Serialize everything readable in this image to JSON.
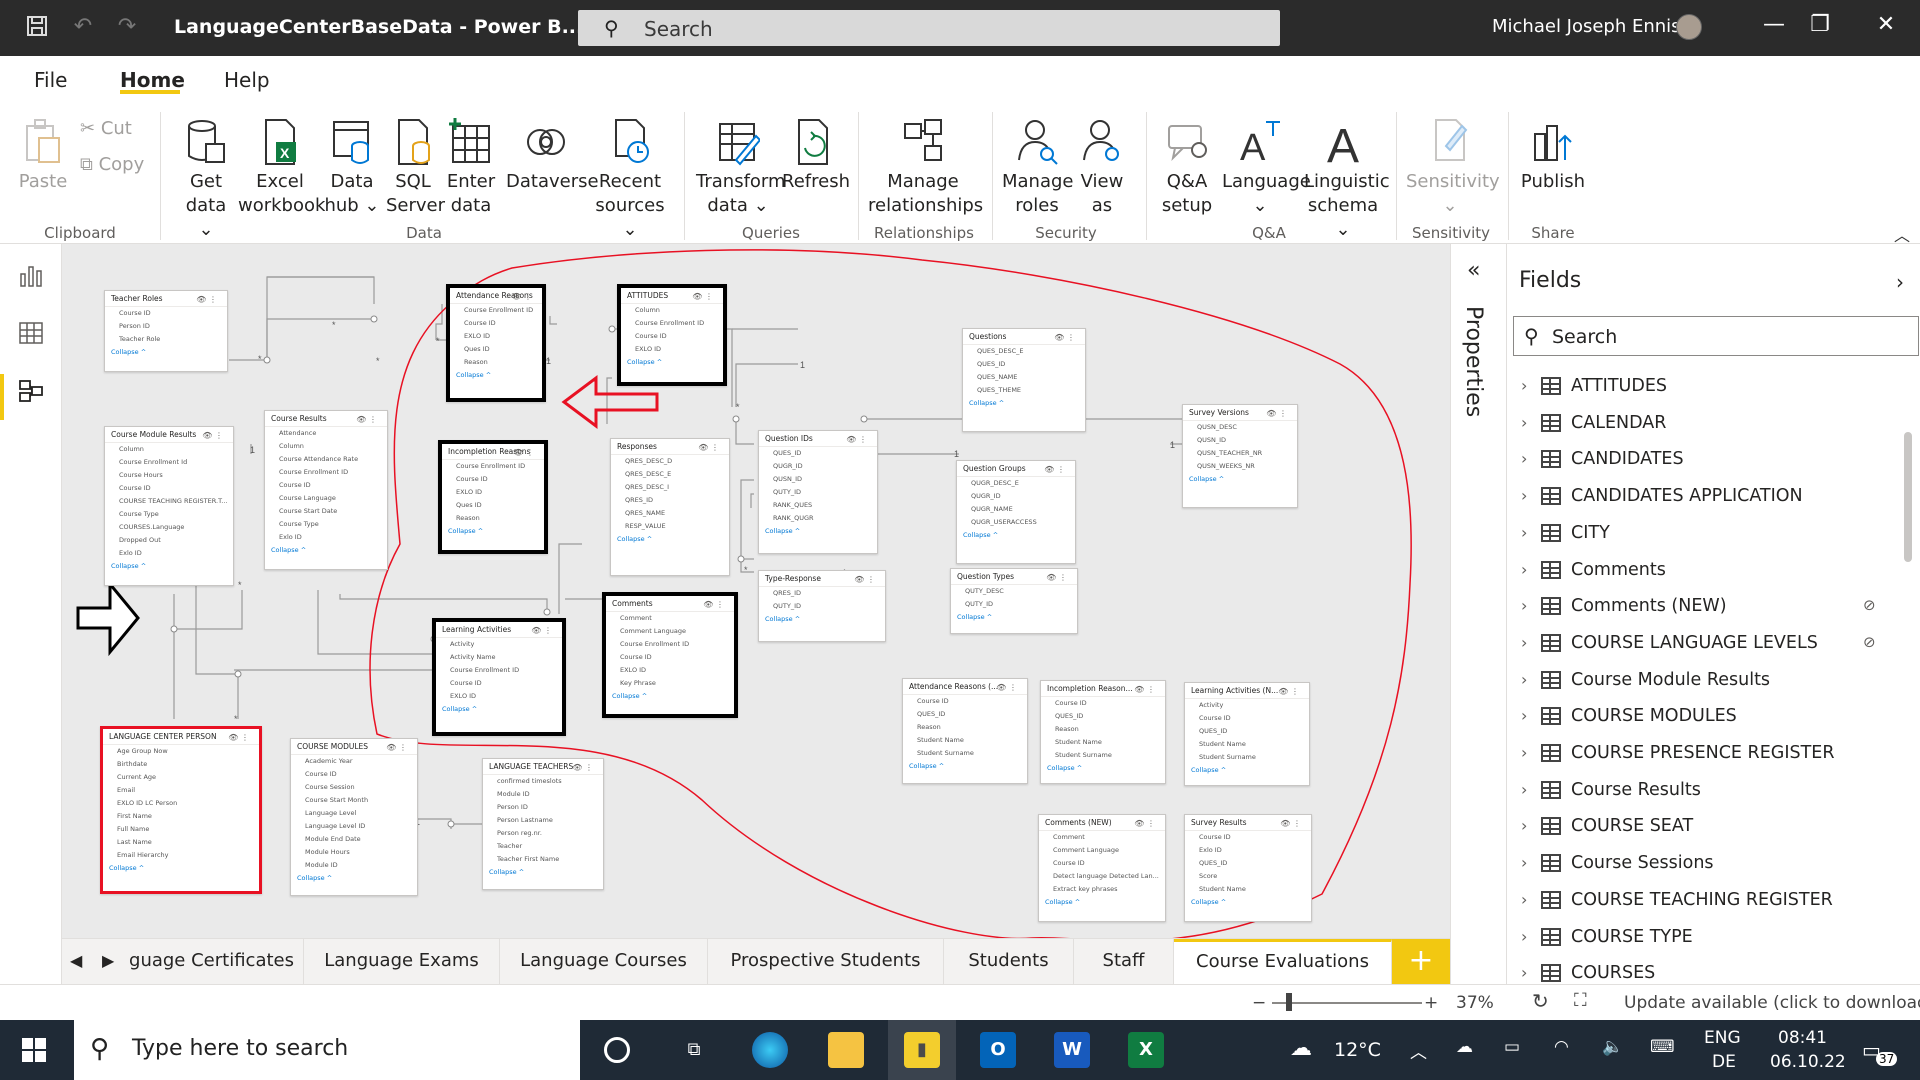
{
  "titlebar": {
    "title": "LanguageCenterBaseData - Power B...",
    "search_placeholder": "Search",
    "user": "Michael Joseph Ennis"
  },
  "menu": {
    "file": "File",
    "home": "Home",
    "help": "Help"
  },
  "ribbon": {
    "paste": "Paste",
    "cut": "Cut",
    "copy": "Copy",
    "get_data": [
      "Get",
      "data ⌄"
    ],
    "excel": [
      "Excel",
      "workbook"
    ],
    "data_hub": [
      "Data",
      "hub ⌄"
    ],
    "sql": [
      "SQL",
      "Server"
    ],
    "enter_data": [
      "Enter",
      "data"
    ],
    "dataverse": [
      "Dataverse"
    ],
    "recent": [
      "Recent",
      "sources ⌄"
    ],
    "transform": [
      "Transform",
      "data ⌄"
    ],
    "refresh": [
      "Refresh"
    ],
    "manage_rel": [
      "Manage",
      "relationships"
    ],
    "manage_roles": [
      "Manage",
      "roles"
    ],
    "view_as": [
      "View",
      "as"
    ],
    "qa_setup": [
      "Q&A",
      "setup"
    ],
    "language": [
      "Language",
      "⌄"
    ],
    "ling": [
      "Linguistic",
      "schema ⌄"
    ],
    "sensitivity": [
      "Sensitivity",
      "⌄"
    ],
    "publish": [
      "Publish"
    ],
    "groups": {
      "clipboard": "Clipboard",
      "data": "Data",
      "queries": "Queries",
      "relationships": "Relationships",
      "security": "Security",
      "qa": "Q&A",
      "sensitivity": "Sensitivity",
      "share": "Share"
    }
  },
  "tables": [
    {
      "id": "t1",
      "title": "Teacher Roles",
      "rows": [
        "Course ID",
        "Person ID",
        "Teacher Role"
      ],
      "hl": ""
    },
    {
      "id": "t2",
      "title": "Attendance Reasons",
      "rows": [
        "Course Enrollment ID",
        "Course ID",
        "EXLO ID",
        "Ques ID",
        "Reason"
      ],
      "hl": "black"
    },
    {
      "id": "t3",
      "title": "ATTITUDES",
      "rows": [
        "Column",
        "Course Enrollment ID",
        "Course ID",
        "EXLO ID"
      ],
      "hl": "black"
    },
    {
      "id": "t4",
      "title": "Questions",
      "rows": [
        "QUES_DESC_E",
        "QUES_ID",
        "QUES_NAME",
        "QUES_THEME"
      ],
      "hl": ""
    },
    {
      "id": "t5",
      "title": "Course Module Results",
      "rows": [
        "Column",
        "Course Enrollment Id",
        "Course Hours",
        "Course ID",
        "COURSE TEACHING REGISTER.T...",
        "Course Type",
        "COURSES.Language",
        "Dropped Out",
        "Exlo ID"
      ],
      "hl": ""
    },
    {
      "id": "t6",
      "title": "Course Results",
      "rows": [
        "Attendance",
        "Column",
        "Course Attendance Rate",
        "Course Enrollment ID",
        "Course ID",
        "Course Language",
        "Course Start Date",
        "Course Type",
        "Exlo ID"
      ],
      "hl": ""
    },
    {
      "id": "t7",
      "title": "Incompletion Reasons",
      "rows": [
        "Course Enrollment ID",
        "Course ID",
        "EXLO ID",
        "Ques ID",
        "Reason"
      ],
      "hl": "black"
    },
    {
      "id": "t8",
      "title": "Responses",
      "rows": [
        "QRES_DESC_D",
        "QRES_DESC_E",
        "QRES_DESC_I",
        "QRES_ID",
        "QRES_NAME",
        "RESP_VALUE"
      ],
      "hl": ""
    },
    {
      "id": "t9",
      "title": "Question IDs",
      "rows": [
        "QUES_ID",
        "QUGR_ID",
        "QUSN_ID",
        "QUTY_ID",
        "RANK_QUES",
        "RANK_QUGR"
      ],
      "hl": ""
    },
    {
      "id": "t10",
      "title": "Question Groups",
      "rows": [
        "QUGR_DESC_E",
        "QUGR_ID",
        "QUGR_NAME",
        "QUGR_USERACCESS"
      ],
      "hl": ""
    },
    {
      "id": "t11",
      "title": "Survey Versions",
      "rows": [
        "QUSN_DESC",
        "QUSN_ID",
        "QUSN_TEACHER_NR",
        "QUSN_WEEKS_NR"
      ],
      "hl": ""
    },
    {
      "id": "t12",
      "title": "Type-Response",
      "rows": [
        "QRES_ID",
        "QUTY_ID"
      ],
      "hl": ""
    },
    {
      "id": "t13",
      "title": "Question Types",
      "rows": [
        "QUTY_DESC",
        "QUTY_ID"
      ],
      "hl": ""
    },
    {
      "id": "t14",
      "title": "Comments",
      "rows": [
        "Comment",
        "Comment Language",
        "Course Enrollment ID",
        "Course ID",
        "EXLO ID",
        "Key Phrase"
      ],
      "hl": "black"
    },
    {
      "id": "t15",
      "title": "Learning Activities",
      "rows": [
        "Activity",
        "Activity Name",
        "Course Enrollment ID",
        "Course ID",
        "EXLO ID"
      ],
      "hl": "black"
    },
    {
      "id": "t16",
      "title": "Attendance Reasons (...",
      "rows": [
        "Course ID",
        "QUES_ID",
        "Reason",
        "Student Name",
        "Student Surname"
      ],
      "hl": ""
    },
    {
      "id": "t17",
      "title": "Incompletion Reason...",
      "rows": [
        "Course ID",
        "QUES_ID",
        "Reason",
        "Student Name",
        "Student Surname"
      ],
      "hl": ""
    },
    {
      "id": "t18",
      "title": "Learning Activities (N...",
      "rows": [
        "Activity",
        "Course ID",
        "QUES_ID",
        "Student Name",
        "Student Surname"
      ],
      "hl": ""
    },
    {
      "id": "t19",
      "title": "LANGUAGE CENTER PERSON",
      "rows": [
        "Age Group Now",
        "Birthdate",
        "Current Age",
        "Email",
        "EXLO ID LC Person",
        "First Name",
        "Full Name",
        "Last Name",
        "Email Hierarchy"
      ],
      "hl": "red"
    },
    {
      "id": "t20",
      "title": "COURSE MODULES",
      "rows": [
        "Academic Year",
        "Course ID",
        "Course Session",
        "Course Start Month",
        "Language Level",
        "Language Level ID",
        "Module End Date",
        "Module Hours",
        "Module ID"
      ],
      "hl": ""
    },
    {
      "id": "t21",
      "title": "LANGUAGE TEACHERS",
      "rows": [
        "confirmed timeslots",
        "Module ID",
        "Person ID",
        "Person Lastname",
        "Person reg.nr.",
        "Teacher",
        "Teacher First Name"
      ],
      "hl": ""
    },
    {
      "id": "t22",
      "title": "Comments (NEW)",
      "rows": [
        "Comment",
        "Comment Language",
        "Course ID",
        "Detect language Detected Lan...",
        "Extract key phrases"
      ],
      "hl": ""
    },
    {
      "id": "t23",
      "title": "Survey Results",
      "rows": [
        "Course ID",
        "Exlo ID",
        "QUES_ID",
        "Score",
        "Student Name"
      ],
      "hl": ""
    }
  ],
  "collapse_label": "Collapse ^",
  "tabs": [
    "guage Certificates",
    "Language Exams",
    "Language Courses",
    "Prospective Students",
    "Students",
    "Staff",
    "Course Evaluations"
  ],
  "properties_label": "Properties",
  "fields": {
    "title": "Fields",
    "search_placeholder": "Search",
    "items": [
      {
        "label": "ATTITUDES",
        "hidden": false
      },
      {
        "label": "CALENDAR",
        "hidden": false
      },
      {
        "label": "CANDIDATES",
        "hidden": false
      },
      {
        "label": "CANDIDATES APPLICATION",
        "hidden": false
      },
      {
        "label": "CITY",
        "hidden": false
      },
      {
        "label": "Comments",
        "hidden": false
      },
      {
        "label": "Comments (NEW)",
        "hidden": true
      },
      {
        "label": "COURSE LANGUAGE LEVELS",
        "hidden": true
      },
      {
        "label": "Course Module Results",
        "hidden": false
      },
      {
        "label": "COURSE MODULES",
        "hidden": false
      },
      {
        "label": "COURSE PRESENCE REGISTER",
        "hidden": false
      },
      {
        "label": "Course Results",
        "hidden": false
      },
      {
        "label": "COURSE SEAT",
        "hidden": false
      },
      {
        "label": "Course Sessions",
        "hidden": false
      },
      {
        "label": "COURSE TEACHING REGISTER",
        "hidden": false
      },
      {
        "label": "COURSE TYPE",
        "hidden": false
      },
      {
        "label": "COURSES",
        "hidden": false
      }
    ]
  },
  "status": {
    "zoom": "37%",
    "update": "Update available (click to download)"
  },
  "taskbar": {
    "search_placeholder": "Type here to search",
    "temp": "12°C",
    "lang1": "ENG",
    "lang2": "DE",
    "time": "08:41",
    "date": "06.10.22",
    "notif": "37"
  }
}
